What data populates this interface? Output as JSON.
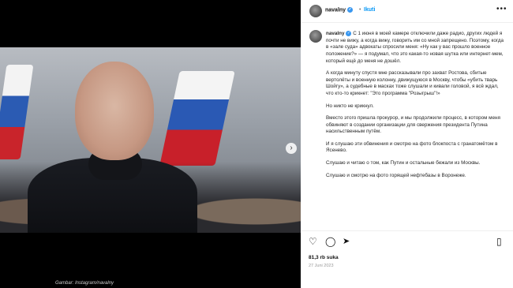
{
  "post": {
    "username": "navalny",
    "separator": "•",
    "follow_label": "Ikuti",
    "more_icon": "more-horizontal-icon",
    "verified_icon": "verified-badge-icon",
    "accent_color": "#0095f6",
    "carousel": {
      "slide_count": 3,
      "current_index": 0
    }
  },
  "caption": {
    "username": "navalny",
    "paragraphs": [
      "С 1 июня в моей камере отключили даже радио, других людей я почти не вижу, а когда вижу, говорить им со мной запрещено. Поэтому, когда в «зале суда» адвокаты спросили меня: «Ну как у вас прошло военное положение?» — я подумал, что это какая-то новая шутка или интернет-мем, который ещё до меня не дошёл.",
      "А когда минуту спустя мне рассказывали про захват Ростова, сбитые вертолёты и военную колонну, движущуюся в Москву, чтобы «убить тварь Шойгу», а судебные в масках тоже слушали и кивали головой, я всё ждал, что кто-то крикнет: \"Это программа \"Розыгрыш\"!»",
      "Но никто не крикнул.",
      "Вместо этого пришла прокурор, и мы продолжили процесс, в котором меня обвиняют в создании организации для свержения президента Путина насильственным путём.",
      "И я слушаю эти обвинения и смотрю на фото блокпоста с гранатомётом в Ясенево.",
      "Слушаю и читаю о том, как Путин и остальные бежали из Москвы.",
      "Слушаю и смотрю на фото горящей нефтебазы в Воронеже."
    ]
  },
  "actions": {
    "icons": [
      "heart-icon",
      "comment-icon",
      "share-icon",
      "bookmark-icon"
    ],
    "likes": "81,3 rb suka",
    "date": "27 Juni 2023"
  },
  "watermark": "Gambar: Instagram/navalny"
}
